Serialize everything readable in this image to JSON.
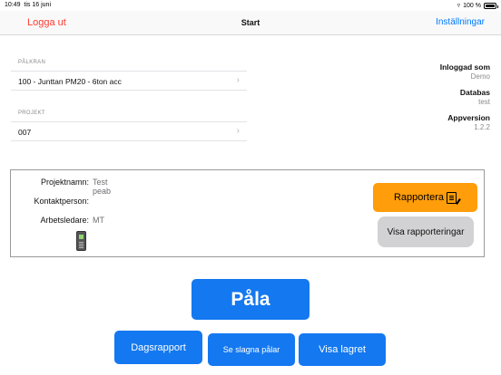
{
  "status_bar": {
    "time": "10:49",
    "date": "tis 16 juni",
    "battery_text": "100 %",
    "wifi_icon": "wifi-icon",
    "battery_icon": "battery-icon"
  },
  "nav": {
    "left_label": "Logga ut",
    "title": "Start",
    "right_label": "Inställningar",
    "colors": {
      "logout": "#ff3b30",
      "settings": "#007aff"
    }
  },
  "palkran": {
    "section_label": "PÅLKRAN",
    "value": "100 - Junttan PM20 - 6ton acc"
  },
  "projekt": {
    "section_label": "PROJEKT",
    "value": "007"
  },
  "info": {
    "logged_in_label": "Inloggad som",
    "logged_in_value": "Demo",
    "database_label": "Databas",
    "database_value": "test",
    "app_version_label": "Appversion",
    "app_version_value": "1.2.2"
  },
  "project_box": {
    "name_label": "Projektnamn:",
    "name_value": "Test peab",
    "contact_label": "Kontaktperson:",
    "contact_value": "",
    "supervisor_label": "Arbetsledare:",
    "supervisor_value": "MT",
    "phone_icon": "phone-icon",
    "report_button": "Rapportera",
    "report_icon": "document-edit-icon",
    "show_reports_button": "Visa rapporteringar",
    "colors": {
      "report": "#ff9d0a",
      "show_reports": "#d2d2d4"
    }
  },
  "actions": {
    "pala": "Påla",
    "daily_report": "Dagsrapport",
    "driven_piles": "Se slagna pålar",
    "show_stock": "Visa lagret",
    "color": "#1478f0"
  }
}
